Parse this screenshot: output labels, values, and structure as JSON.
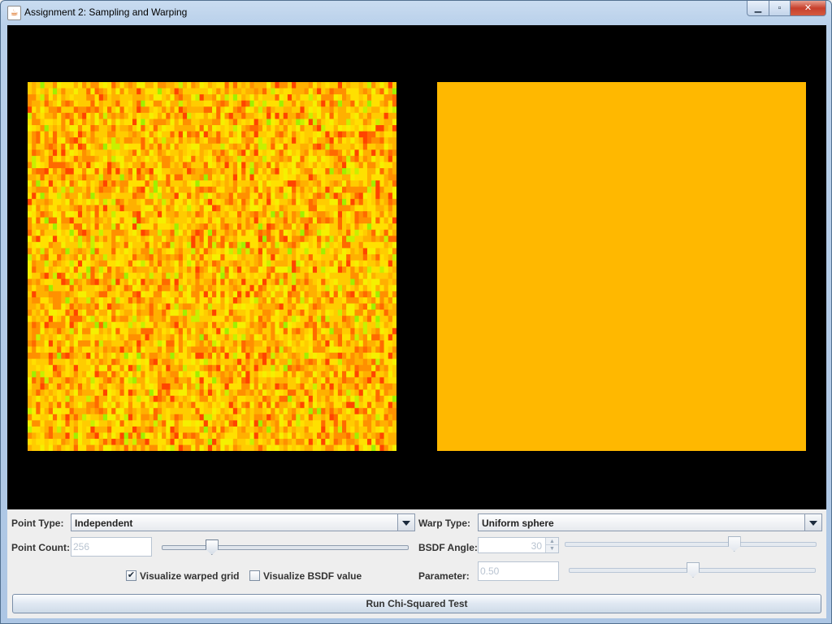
{
  "window": {
    "title": "Assignment 2: Sampling and Warping",
    "buttons": {
      "minimize": "▁",
      "maximize": "▫",
      "close": "✕"
    },
    "icon": "java-app-icon"
  },
  "canvas": {
    "heatmap_colors": [
      "#ff4400",
      "#ff6a00",
      "#ff9000",
      "#ffb000",
      "#ffcc00",
      "#ffe000",
      "#f5f000",
      "#c8f000",
      "#a0f000"
    ],
    "reference_color": "#ffb800"
  },
  "controls": {
    "point_type": {
      "label": "Point Type:",
      "value": "Independent"
    },
    "warp_type": {
      "label": "Warp Type:",
      "value": "Uniform sphere"
    },
    "point_count": {
      "label": "Point Count:",
      "value": "256",
      "slider_fraction": 0.2
    },
    "bsdf_angle": {
      "label": "BSDF Angle:",
      "value": "30",
      "slider_fraction": 0.67
    },
    "parameter": {
      "label": "Parameter:",
      "value": "0.50",
      "slider_fraction": 0.5
    },
    "visualize_warped_grid": {
      "label": "Visualize warped grid",
      "checked": true,
      "mark": "✔"
    },
    "visualize_bsdf_value": {
      "label": "Visualize BSDF value",
      "checked": false,
      "mark": ""
    },
    "run_button": "Run Chi-Squared Test"
  }
}
